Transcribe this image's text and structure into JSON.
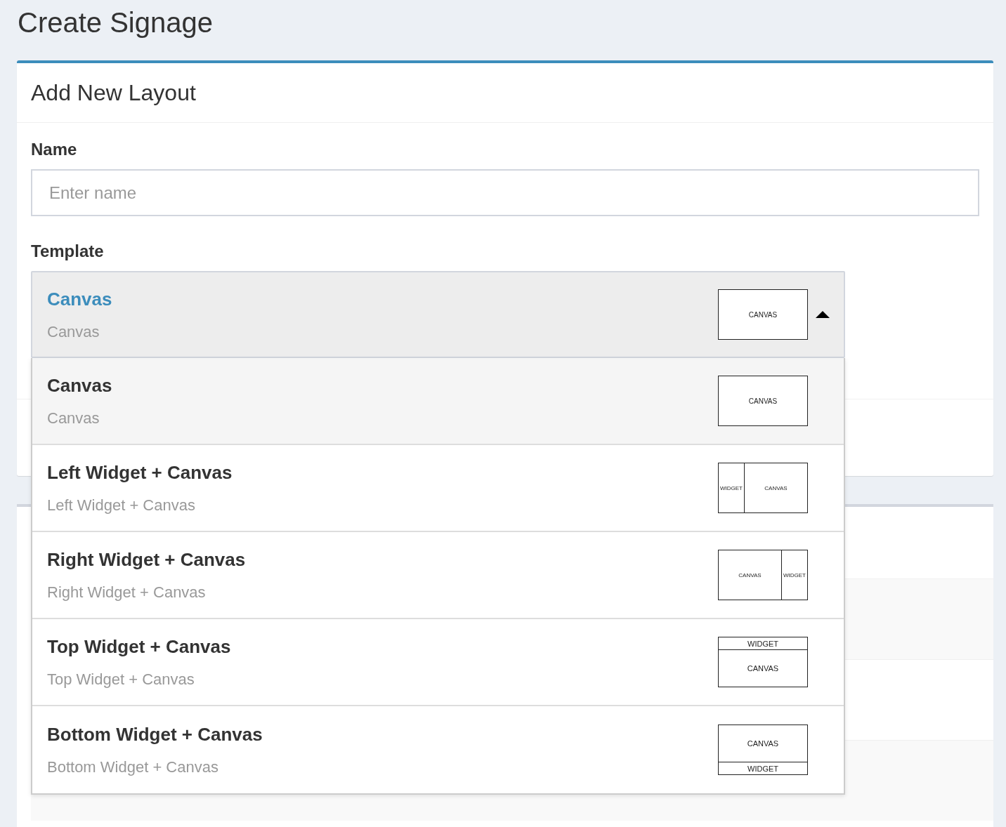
{
  "page_title": "Create Signage",
  "card": {
    "title": "Add New Layout"
  },
  "form": {
    "name_label": "Name",
    "name_placeholder": "Enter name",
    "template_label": "Template"
  },
  "template_select": {
    "expanded": true,
    "value": {
      "title": "Canvas",
      "subtitle": "Canvas",
      "kind": "canvas",
      "parts": [
        {
          "label": "CANVAS",
          "kind": "canvas"
        }
      ]
    }
  },
  "options": [
    {
      "title": "Canvas",
      "subtitle": "Canvas",
      "kind": "canvas",
      "selected": true,
      "parts": [
        {
          "label": "CANVAS",
          "kind": "canvas"
        }
      ]
    },
    {
      "title": "Left Widget + Canvas",
      "subtitle": "Left Widget + Canvas",
      "kind": "left",
      "selected": false,
      "parts": [
        {
          "label": "WIDGET",
          "kind": "widget"
        },
        {
          "label": "CANVAS",
          "kind": "canvas"
        }
      ]
    },
    {
      "title": "Right Widget + Canvas",
      "subtitle": "Right Widget + Canvas",
      "kind": "right",
      "selected": false,
      "parts": [
        {
          "label": "CANVAS",
          "kind": "canvas"
        },
        {
          "label": "WIDGET",
          "kind": "widget"
        }
      ]
    },
    {
      "title": "Top Widget + Canvas",
      "subtitle": "Top Widget + Canvas",
      "kind": "top",
      "selected": false,
      "parts": [
        {
          "label": "WIDGET",
          "kind": "widget"
        },
        {
          "label": "CANVAS",
          "kind": "canvas"
        }
      ]
    },
    {
      "title": "Bottom Widget + Canvas",
      "subtitle": "Bottom Widget + Canvas",
      "kind": "bottom",
      "selected": false,
      "parts": [
        {
          "label": "CANVAS",
          "kind": "canvas"
        },
        {
          "label": "WIDGET",
          "kind": "widget"
        }
      ]
    }
  ]
}
